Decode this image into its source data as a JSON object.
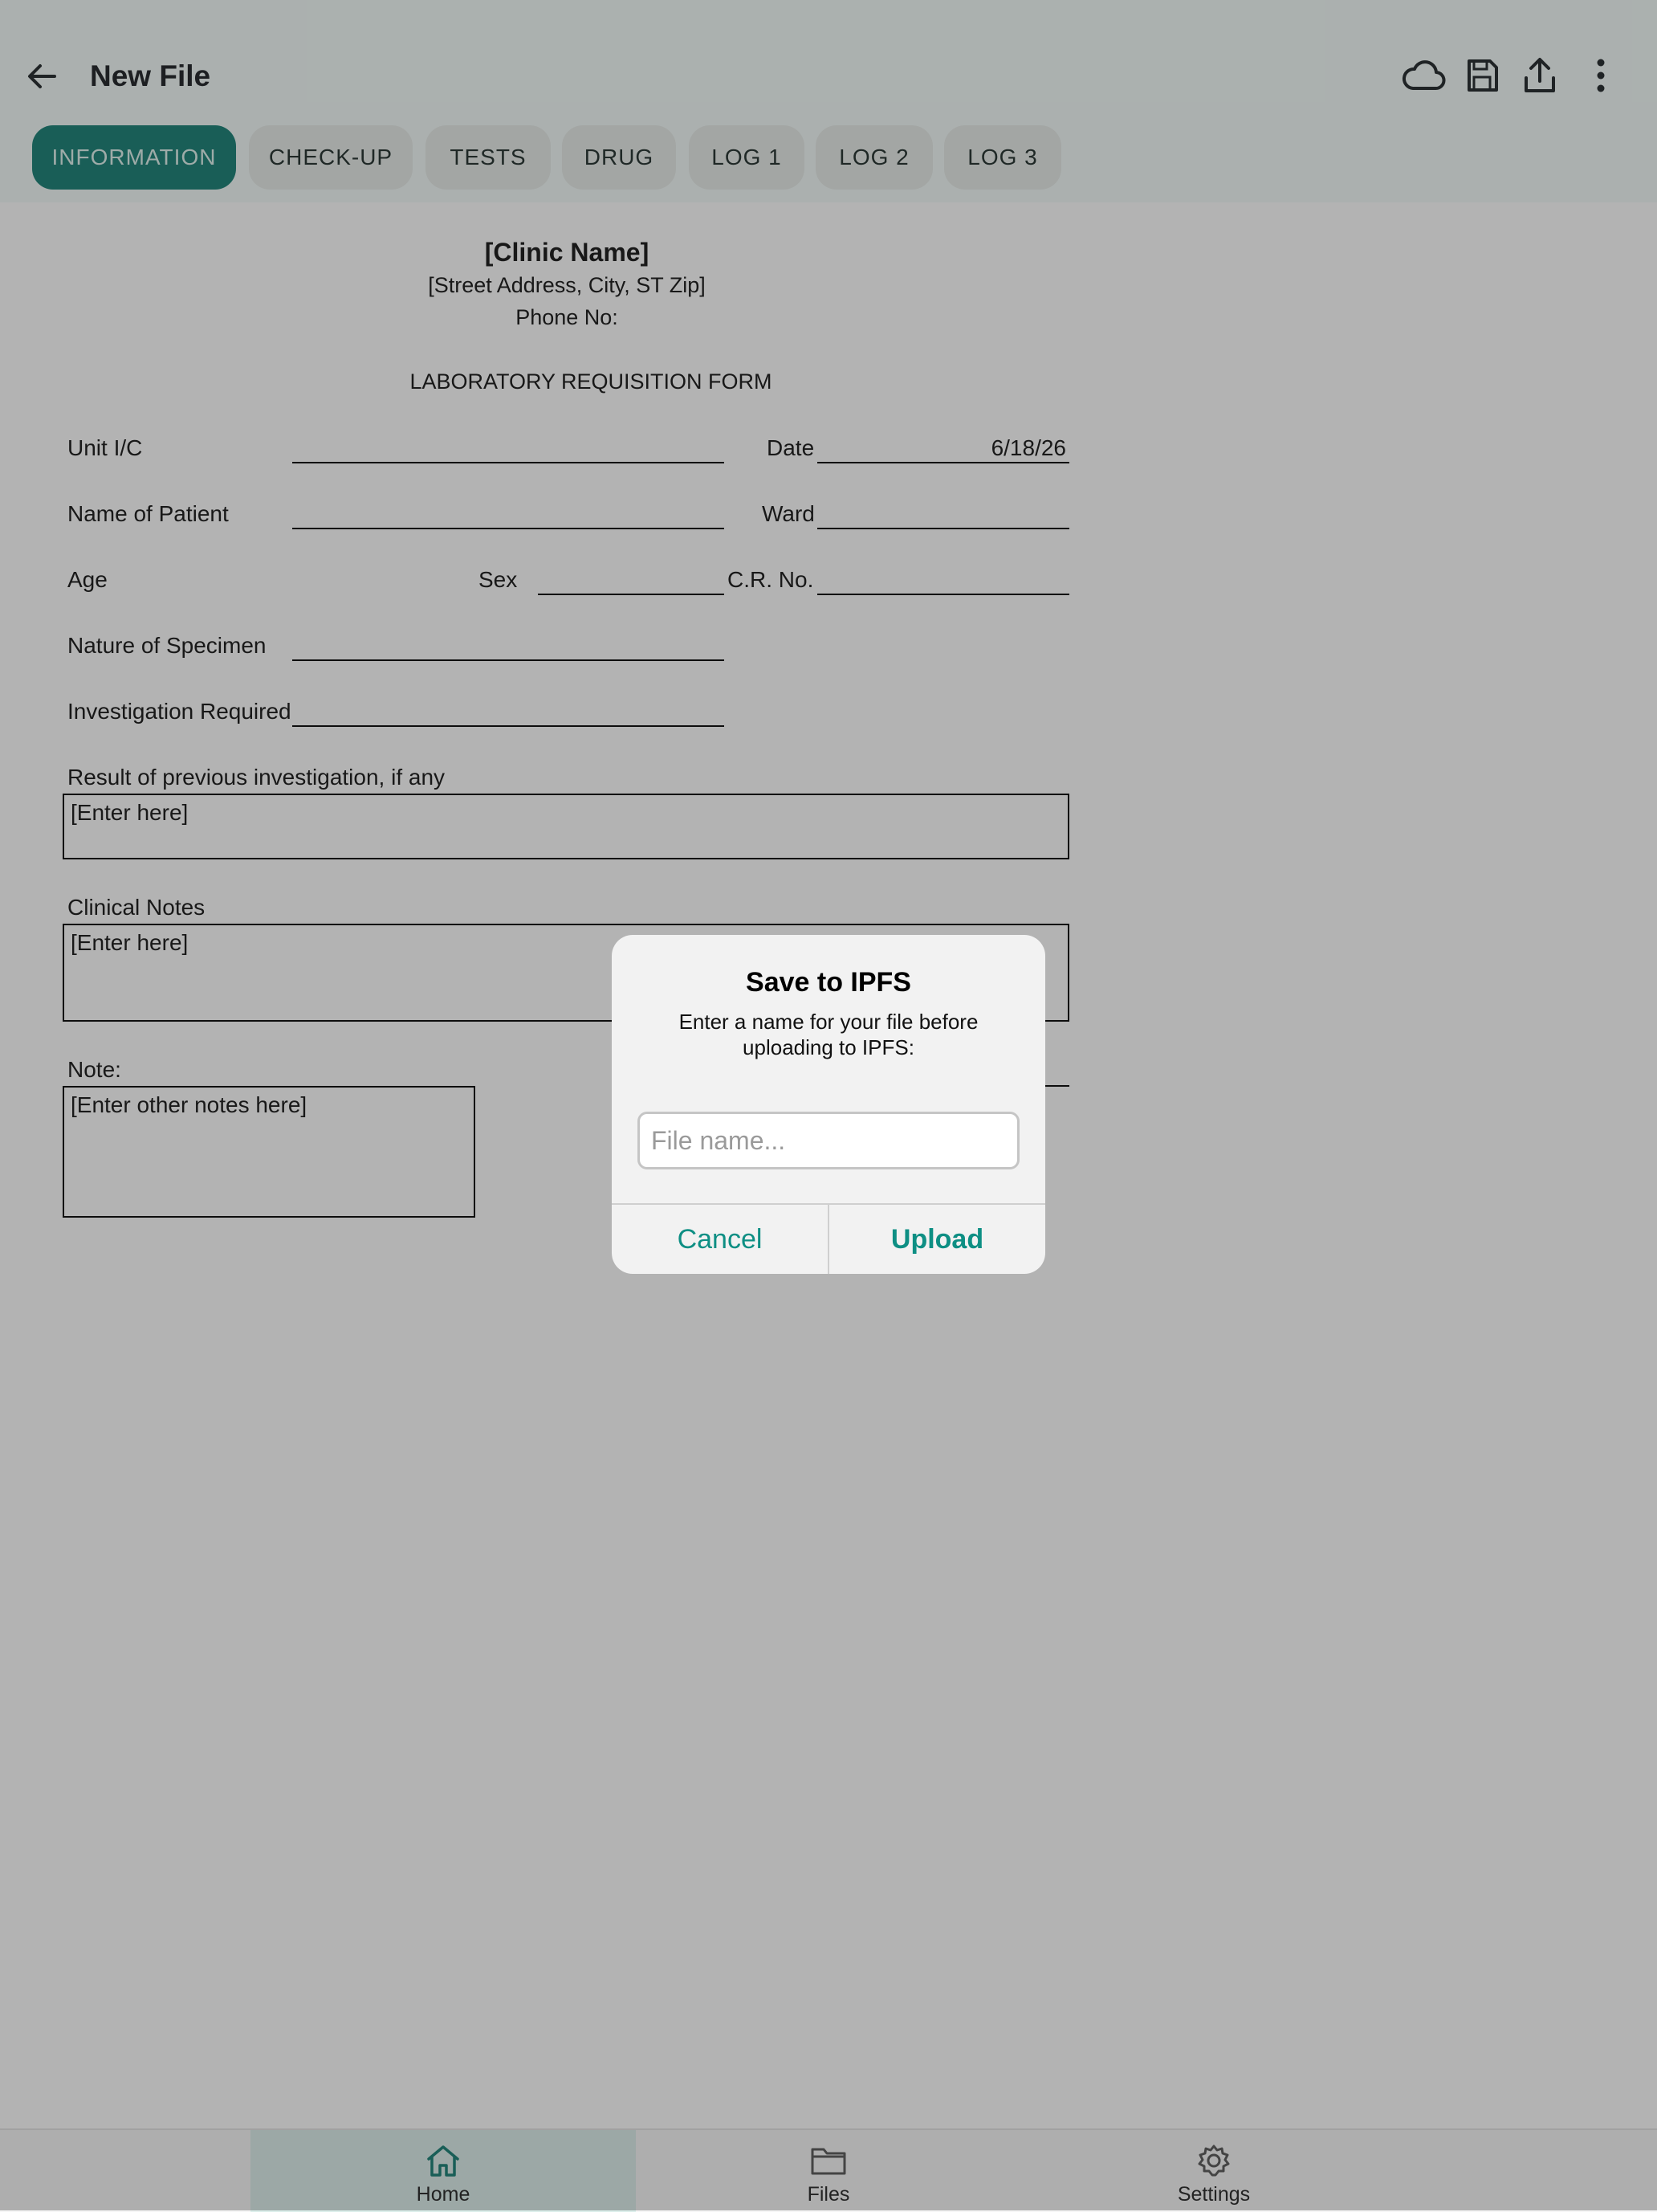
{
  "app_bar": {
    "title": "New File",
    "icons": [
      "back-arrow-icon",
      "cloud-icon",
      "save-icon",
      "share-icon",
      "more-vert-icon"
    ]
  },
  "tabs": [
    {
      "label": "INFORMATION",
      "active": true
    },
    {
      "label": "CHECK-UP",
      "active": false
    },
    {
      "label": "TESTS",
      "active": false
    },
    {
      "label": "DRUG",
      "active": false
    },
    {
      "label": "LOG 1",
      "active": false
    },
    {
      "label": "LOG 2",
      "active": false
    },
    {
      "label": "LOG 3",
      "active": false
    }
  ],
  "form": {
    "clinic_name": "[Clinic Name]",
    "address": "[Street Address, City, ST Zip]",
    "phone": "Phone No:",
    "form_title": "LABORATORY REQUISITION FORM",
    "labels": {
      "unit": "Unit I/C",
      "date": "Date",
      "patient_name": "Name of Patient",
      "ward": "Ward",
      "age": "Age",
      "sex": "Sex",
      "cr_no": "C.R. No.",
      "specimen": "Nature of Specimen",
      "investigation": "Investigation Required",
      "previous_result": "Result of previous investigation, if any",
      "clinical_notes": "Clinical Notes",
      "note": "Note:"
    },
    "values": {
      "date": "6/18/26",
      "previous_result": "[Enter here]",
      "clinical_notes": "[Enter here]",
      "note": "[Enter other notes here]"
    }
  },
  "dialog": {
    "title": "Save to IPFS",
    "message": "Enter a name for your file before uploading to IPFS:",
    "input_placeholder": "File name...",
    "input_value": "",
    "cancel_label": "Cancel",
    "upload_label": "Upload"
  },
  "bottom_nav": [
    {
      "label": "Home",
      "icon": "home-icon",
      "active": true
    },
    {
      "label": "Files",
      "icon": "folder-icon",
      "active": false
    },
    {
      "label": "Settings",
      "icon": "gear-icon",
      "active": false
    }
  ],
  "colors": {
    "accent": "#137d72",
    "dialog_button_text": "#0e8f84",
    "scrim": "rgba(38,38,38,0.35)"
  }
}
